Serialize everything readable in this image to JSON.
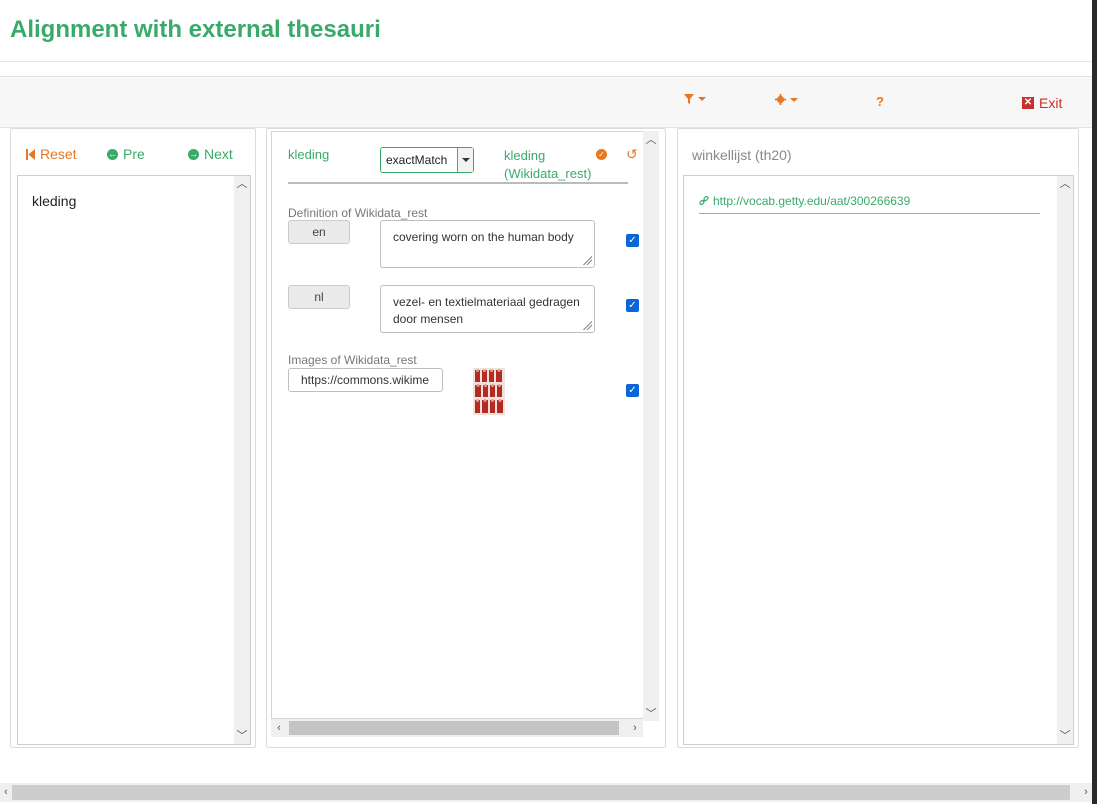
{
  "header": {
    "title": "Alignment with external thesauri"
  },
  "toolbar": {
    "filter_icon": "filter-icon",
    "settings_icon": "gear-icon",
    "help_label": "?",
    "exit_label": "Exit"
  },
  "left_panel": {
    "reset_label": "Reset",
    "pre_label": "Pre",
    "next_label": "Next",
    "items": [
      {
        "label": "kleding"
      }
    ]
  },
  "middle_panel": {
    "source_term": "kleding",
    "match_type": "exactMatch",
    "target_term": "kleding (Wikidata_rest)",
    "definition_heading": "Definition of Wikidata_rest",
    "definitions": [
      {
        "lang": "en",
        "text": "covering worn on the human body",
        "checked": true
      },
      {
        "lang": "nl",
        "text": "vezel- en textielmateriaal gedragen door mensen",
        "checked": true
      }
    ],
    "images_heading": "Images of Wikidata_rest",
    "image_url": "https://commons.wikime",
    "image_checked": true
  },
  "right_panel": {
    "title": "winkellijst (th20)",
    "links": [
      "http://vocab.getty.edu/aat/300266639"
    ]
  },
  "colors": {
    "brand_green": "#3aaa6a",
    "accent_orange": "#e87722",
    "exit_red": "#c9302c",
    "checkbox_blue": "#0a66d8"
  }
}
